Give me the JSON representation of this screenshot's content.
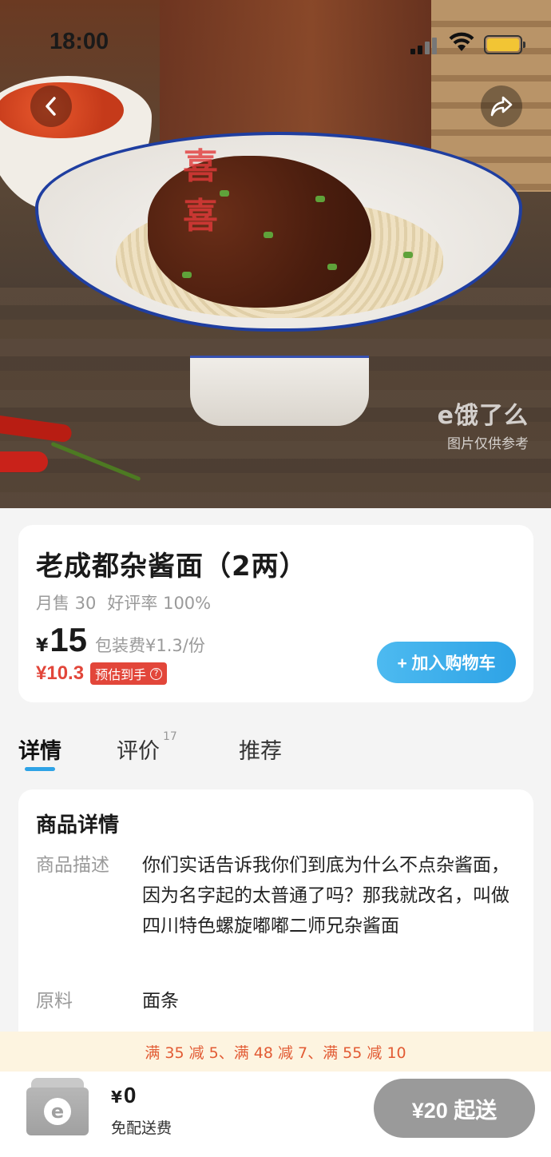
{
  "status_bar": {
    "time": "18:00"
  },
  "hero": {
    "watermark_logo": "e饿了么",
    "watermark_note": "图片仅供参考",
    "plate_stamp": "喜喜"
  },
  "product": {
    "title": "老成都杂酱面（2两）",
    "monthly_sales": "月售 30",
    "rating": "好评率 100%",
    "currency": "¥",
    "price": "15",
    "packaging_fee": "包装费¥1.3/份",
    "estimated_price": "¥10.3",
    "estimated_badge": "预估到手",
    "estimated_badge_icon": "?",
    "add_to_cart": "+ 加入购物车"
  },
  "tabs": {
    "details": "详情",
    "reviews": "评价",
    "reviews_count": "17",
    "recommend": "推荐"
  },
  "details": {
    "heading": "商品详情",
    "description_label": "商品描述",
    "description": "你们实话告诉我你们到底为什么不点杂酱面，因为名字起的太普通了吗？那我就改名，叫做四川特色螺旋嘟嘟二师兄杂酱面",
    "ingredients_label": "原料",
    "ingredients": "面条"
  },
  "promo": {
    "text": "满 35 减 5、满 48 减 7、满 55 减 10"
  },
  "bottom_bar": {
    "cart_currency": "¥",
    "cart_total": "0",
    "delivery_fee": "免配送费",
    "min_order": "¥20 起送"
  },
  "colors": {
    "accent_blue": "#2ea3e6",
    "price_red": "#e2463a",
    "promo_bg": "#fdf4e0",
    "battery": "#f2c534"
  }
}
